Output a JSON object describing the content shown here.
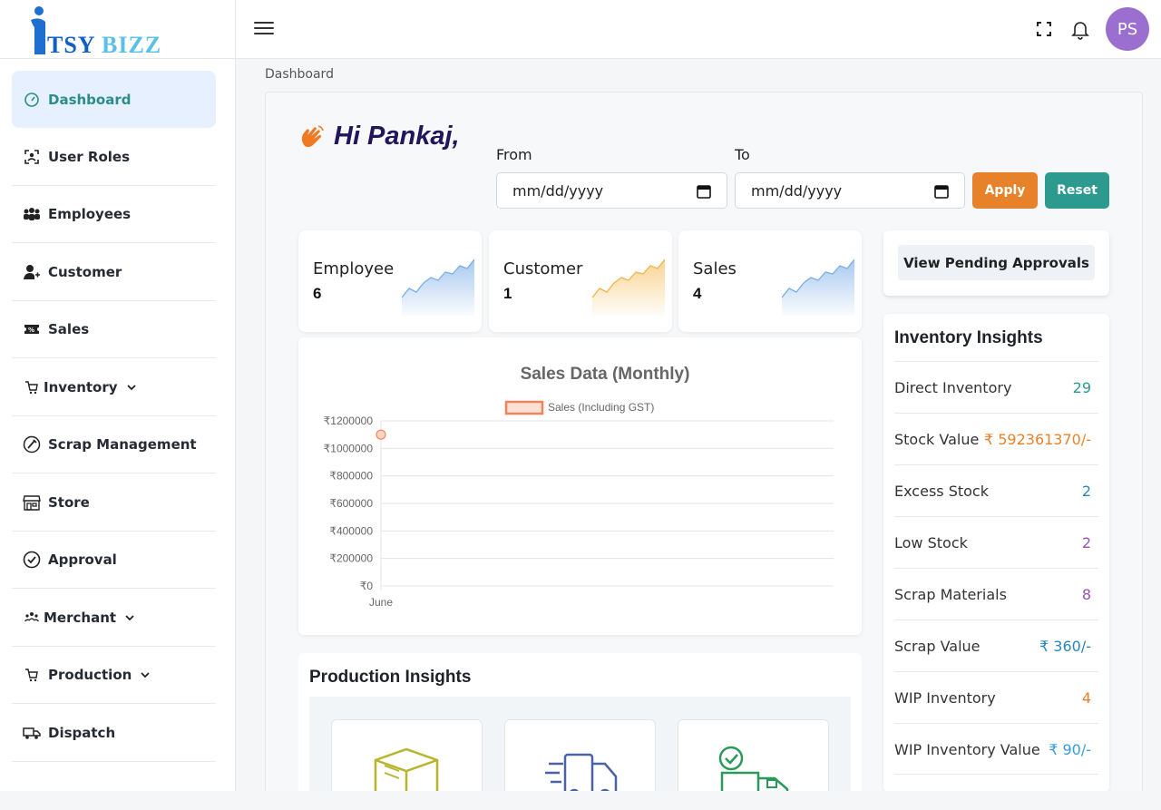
{
  "header": {
    "logo_text": "TSYBIZZ",
    "avatar_initials": "PS"
  },
  "sidebar": {
    "items": [
      {
        "label": "Dashboard",
        "icon": "speedometer-icon",
        "active": true
      },
      {
        "label": "User Roles",
        "icon": "user-scan-icon"
      },
      {
        "label": "Employees",
        "icon": "people-icon"
      },
      {
        "label": "Customer",
        "icon": "person-add-icon"
      },
      {
        "label": "Sales",
        "icon": "ticket-icon"
      },
      {
        "label": "Inventory",
        "icon": "cart-icon",
        "has_submenu": true
      },
      {
        "label": "Scrap Management",
        "icon": "scrap-icon"
      },
      {
        "label": "Store",
        "icon": "store-icon"
      },
      {
        "label": "Approval",
        "icon": "check-circle-icon"
      },
      {
        "label": "Merchant",
        "icon": "group-icon",
        "has_submenu": true
      },
      {
        "label": "Production",
        "icon": "cart-icon",
        "has_submenu": true
      },
      {
        "label": "Dispatch",
        "icon": "truck-icon"
      }
    ]
  },
  "breadcrumb": "Dashboard",
  "greeting": "Hi Pankaj,",
  "filters": {
    "from_label": "From",
    "to_label": "To",
    "from_value": "mm/dd/yyyy",
    "to_value": "mm/dd/yyyy",
    "apply_label": "Apply",
    "reset_label": "Reset"
  },
  "stats": [
    {
      "title": "Employee",
      "value": "6",
      "color": "#9ec3ee"
    },
    {
      "title": "Customer",
      "value": "1",
      "color": "#f8cf85"
    },
    {
      "title": "Sales",
      "value": "4",
      "color": "#9ec3ee"
    }
  ],
  "pending_approvals_label": "View Pending Approvals",
  "inventory": {
    "title": "Inventory Insights",
    "rows": [
      {
        "label": "Direct Inventory",
        "value": "29",
        "color": "#2c9a8e"
      },
      {
        "label": "Stock Value",
        "value": "₹ 592361370/-",
        "color": "#e8822a"
      },
      {
        "label": "Excess Stock",
        "value": "2",
        "color": "#2a86b8"
      },
      {
        "label": "Low Stock",
        "value": "2",
        "color": "#9b4fb8"
      },
      {
        "label": "Scrap Materials",
        "value": "8",
        "color": "#9b4fb8"
      },
      {
        "label": "Scrap Value",
        "value": "₹ 360/-",
        "color": "#2a86b8"
      },
      {
        "label": "WIP Inventory",
        "value": "4",
        "color": "#e8822a"
      },
      {
        "label": "WIP Inventory Value",
        "value": "₹ 90/-",
        "color": "#3a9ad9"
      }
    ]
  },
  "production": {
    "title": "Production Insights"
  },
  "chart_data": {
    "type": "line",
    "title": "Sales Data (Monthly)",
    "categories": [
      "June"
    ],
    "series": [
      {
        "name": "Sales (Including GST)",
        "values": [
          1100000
        ],
        "color": "#f0845c"
      }
    ],
    "yticks": [
      "₹1200000",
      "₹1000000",
      "₹800000",
      "₹600000",
      "₹400000",
      "₹200000",
      "₹0"
    ],
    "ylim": [
      0,
      1200000
    ],
    "grid": true,
    "legend": "top"
  }
}
